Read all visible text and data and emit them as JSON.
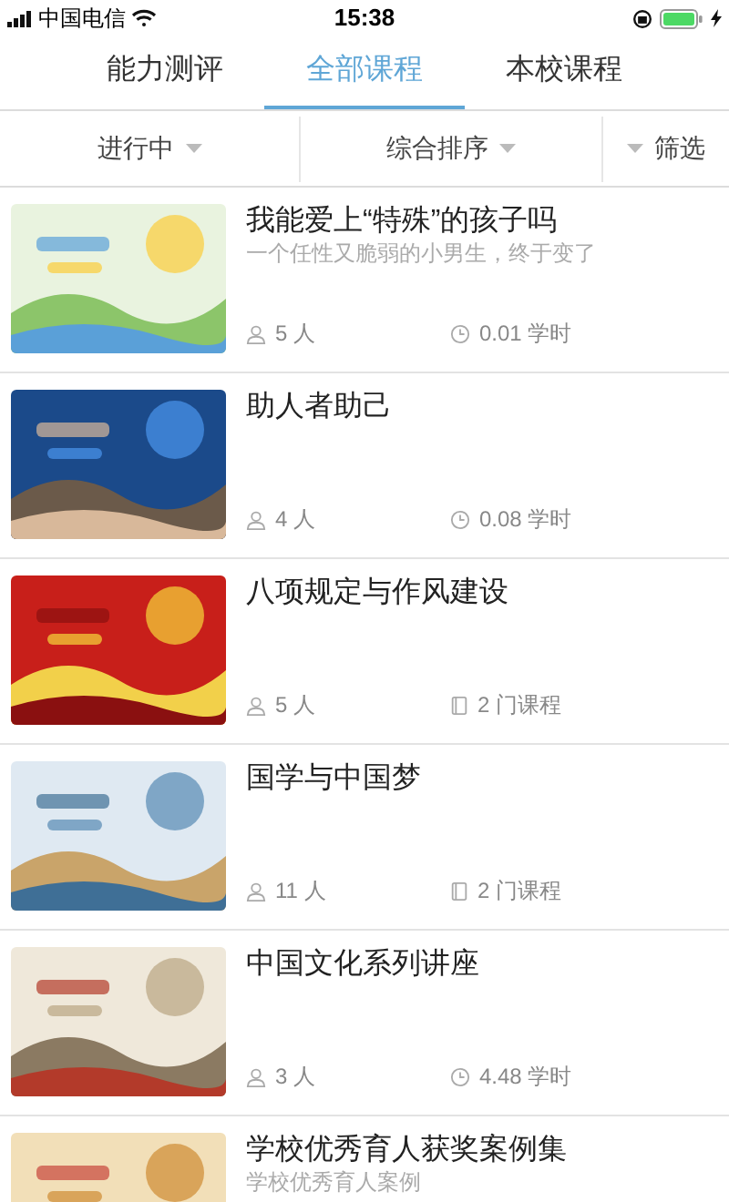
{
  "status_bar": {
    "carrier": "中国电信",
    "time": "15:38",
    "charging": true
  },
  "tabs": [
    {
      "label": "能力测评",
      "selected": false
    },
    {
      "label": "全部课程",
      "selected": true
    },
    {
      "label": "本校课程",
      "selected": false
    }
  ],
  "filters": [
    {
      "label": "进行中",
      "kind": "dropdown"
    },
    {
      "label": "综合排序",
      "kind": "dropdown"
    },
    {
      "label": "筛选",
      "kind": "filter"
    }
  ],
  "courses": [
    {
      "title": "我能爱上“特殊”的孩子吗",
      "subtitle": "一个任性又脆弱的小男生，终于变了",
      "learners": "5 人",
      "stat": {
        "kind": "hours",
        "text": "0.01 学时"
      }
    },
    {
      "title": "助人者助己",
      "learners": "4 人",
      "stat": {
        "kind": "hours",
        "text": "0.08 学时"
      }
    },
    {
      "title": "八项规定与作风建设",
      "learners": "5 人",
      "stat": {
        "kind": "courses",
        "text": "2 门课程"
      }
    },
    {
      "title": "国学与中国梦",
      "learners": "11 人",
      "stat": {
        "kind": "courses",
        "text": "2 门课程"
      }
    },
    {
      "title": "中国文化系列讲座",
      "learners": "3 人",
      "stat": {
        "kind": "hours",
        "text": "4.48 学时"
      }
    },
    {
      "title": "学校优秀育人获奖案例集",
      "subtitle": "学校优秀育人案例"
    }
  ]
}
